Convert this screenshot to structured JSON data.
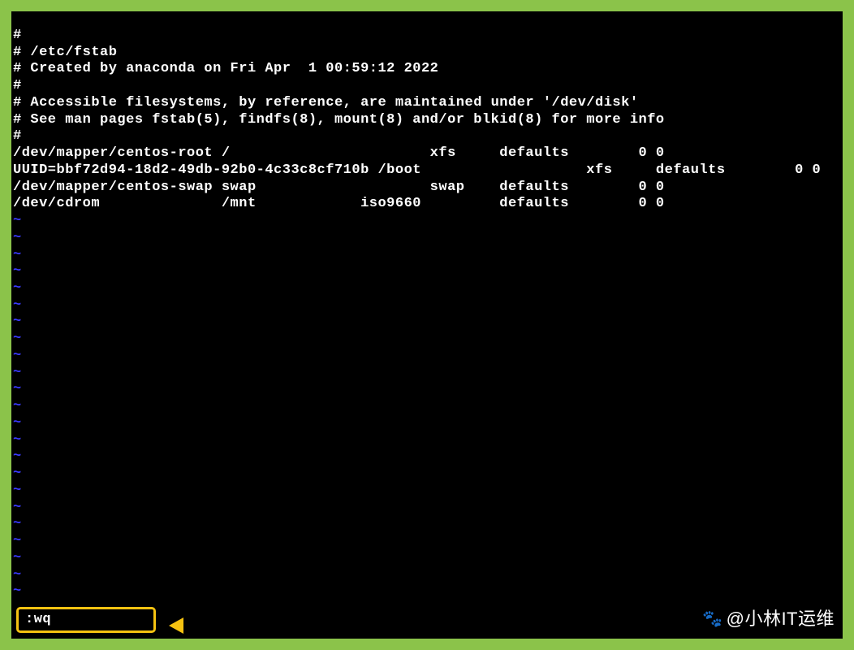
{
  "file_content": {
    "lines": [
      "#",
      "# /etc/fstab",
      "# Created by anaconda on Fri Apr  1 00:59:12 2022",
      "#",
      "# Accessible filesystems, by reference, are maintained under '/dev/disk'",
      "# See man pages fstab(5), findfs(8), mount(8) and/or blkid(8) for more info",
      "#",
      "/dev/mapper/centos-root /                       xfs     defaults        0 0",
      "UUID=bbf72d94-18d2-49db-92b0-4c33c8cf710b /boot                   xfs     defaults        0 0",
      "/dev/mapper/centos-swap swap                    swap    defaults        0 0",
      "/dev/cdrom              /mnt            iso9660         defaults        0 0"
    ]
  },
  "tilde_count": 23,
  "command": ":wq",
  "watermark": "@小林IT运维"
}
